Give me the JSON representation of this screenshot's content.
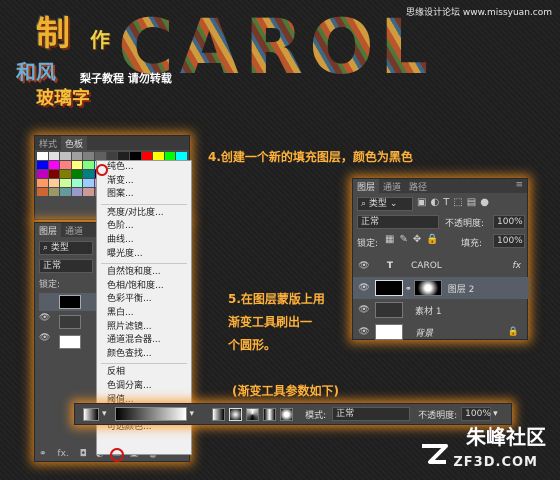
{
  "header": {
    "hero_title": "CAROL",
    "logo_main": "制",
    "logo_sub": "作",
    "logo_line2": "和风",
    "logo_line3": "玻璃字",
    "logo_note": "梨子教程 请勿转载",
    "site_mark": "思缘设计论坛 www.missyuan.com"
  },
  "swatch_panel": {
    "tabs": [
      "样式",
      "色板"
    ],
    "swatches": [
      "#ffffff",
      "#e0e0e0",
      "#c0c0c0",
      "#a0a0a0",
      "#808080",
      "#606060",
      "#404040",
      "#202020",
      "#000000",
      "#ff0000",
      "#ffff00",
      "#00ff00",
      "#00ffff",
      "#0000ff",
      "#ff00ff",
      "#ff8080",
      "#ffff80",
      "#80ff80",
      "#80ffff",
      "#8080ff",
      "#ff80ff",
      "#c00000",
      "#c0c000",
      "#00c000",
      "#00c0c0",
      "#0000c0",
      "#c000c0",
      "#800000",
      "#808000",
      "#008000",
      "#008080",
      "#000080",
      "#800080",
      "#ff6600",
      "#ffcc00",
      "#66cc00",
      "#0066cc",
      "#6600cc",
      "#cc0066",
      "#ff9966",
      "#ffcc99",
      "#ccff99",
      "#99ffcc",
      "#99ccff",
      "#cc99ff",
      "#ff99cc",
      "#996633",
      "#663300",
      "#336600",
      "#003366",
      "#330066",
      "#660033",
      "#cc6633",
      "#999966",
      "#669999",
      "#9999cc",
      "#cc9999",
      "#996666",
      "#666699",
      "#339966",
      "#cc3333",
      "#33cc33",
      "#3333cc",
      "#cccc33",
      "#33cccc"
    ]
  },
  "layers_small": {
    "tabs": [
      "图层",
      "通道"
    ],
    "kind_label": "类型",
    "blend_label": "正常",
    "lock_label": "锁定:"
  },
  "adjustment_menu": {
    "items": [
      "纯色...",
      "渐变...",
      "图案...",
      "---",
      "亮度/对比度...",
      "色阶...",
      "曲线...",
      "曝光度...",
      "---",
      "自然饱和度...",
      "色相/饱和度...",
      "色彩平衡...",
      "黑白...",
      "照片滤镜...",
      "通道混合器...",
      "颜色查找...",
      "---",
      "反相",
      "色调分离...",
      "阈值...",
      "渐变映射...",
      "可选颜色..."
    ]
  },
  "instructions": {
    "step4": "4.创建一个新的填充图层，颜色为黑色",
    "step5_line1": "5.在图层蒙版上用",
    "step5_line2": "渐变工具刷出一",
    "step5_line3": "个圆形。",
    "params_note": "(渐变工具参数如下)"
  },
  "layers_panel": {
    "tabs": [
      "图层",
      "通道",
      "路径"
    ],
    "kind_label": "类型",
    "blend_mode": "正常",
    "opacity_label": "不透明度:",
    "opacity_value": "100%",
    "lock_label": "锁定:",
    "fill_label": "填充:",
    "fill_value": "100%",
    "layers": [
      {
        "name": "CAROL",
        "type": "text",
        "fx": "fx"
      },
      {
        "name": "图层 2",
        "type": "mask"
      },
      {
        "name": "素材 1",
        "type": "image"
      },
      {
        "name": "背景",
        "type": "background"
      }
    ]
  },
  "options_bar": {
    "mode_label": "模式:",
    "mode_value": "正常",
    "opacity_label": "不透明度:",
    "opacity_value": "100%"
  },
  "brand": {
    "name": "朱峰社区",
    "url": "ZF3D.COM"
  },
  "colors": {
    "accent_glow": "#ff9a1e",
    "note_orange": "#ffb23a",
    "marker_red": "#d01616"
  }
}
